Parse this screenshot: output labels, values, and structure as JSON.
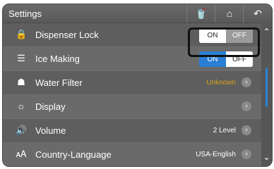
{
  "header": {
    "title": "Settings",
    "filter_icon": "filter-cup-icon",
    "home_icon": "home-icon",
    "back_icon": "back-arrow-icon"
  },
  "rows": [
    {
      "label": "Dispenser Lock",
      "icon": "lock-icon",
      "on_label": "ON",
      "off_label": "OFF",
      "selected": "ON"
    },
    {
      "label": "Ice Making",
      "icon": "ice-cup-icon",
      "on_label": "ON",
      "off_label": "OFF",
      "selected": "ON"
    },
    {
      "label": "Water Filter",
      "icon": "water-filter-icon",
      "value": "Unknown",
      "value_color": "#d6a21a"
    },
    {
      "label": "Display",
      "icon": "sun-icon"
    },
    {
      "label": "Volume",
      "icon": "speaker-icon",
      "value": "2 Level"
    },
    {
      "label": "Country-Language",
      "icon": "language-icon",
      "value": "USA-English"
    }
  ],
  "colors": {
    "accent": "#2a7fd4",
    "panel": "#5e5e5e",
    "warning": "#d6a21a"
  }
}
